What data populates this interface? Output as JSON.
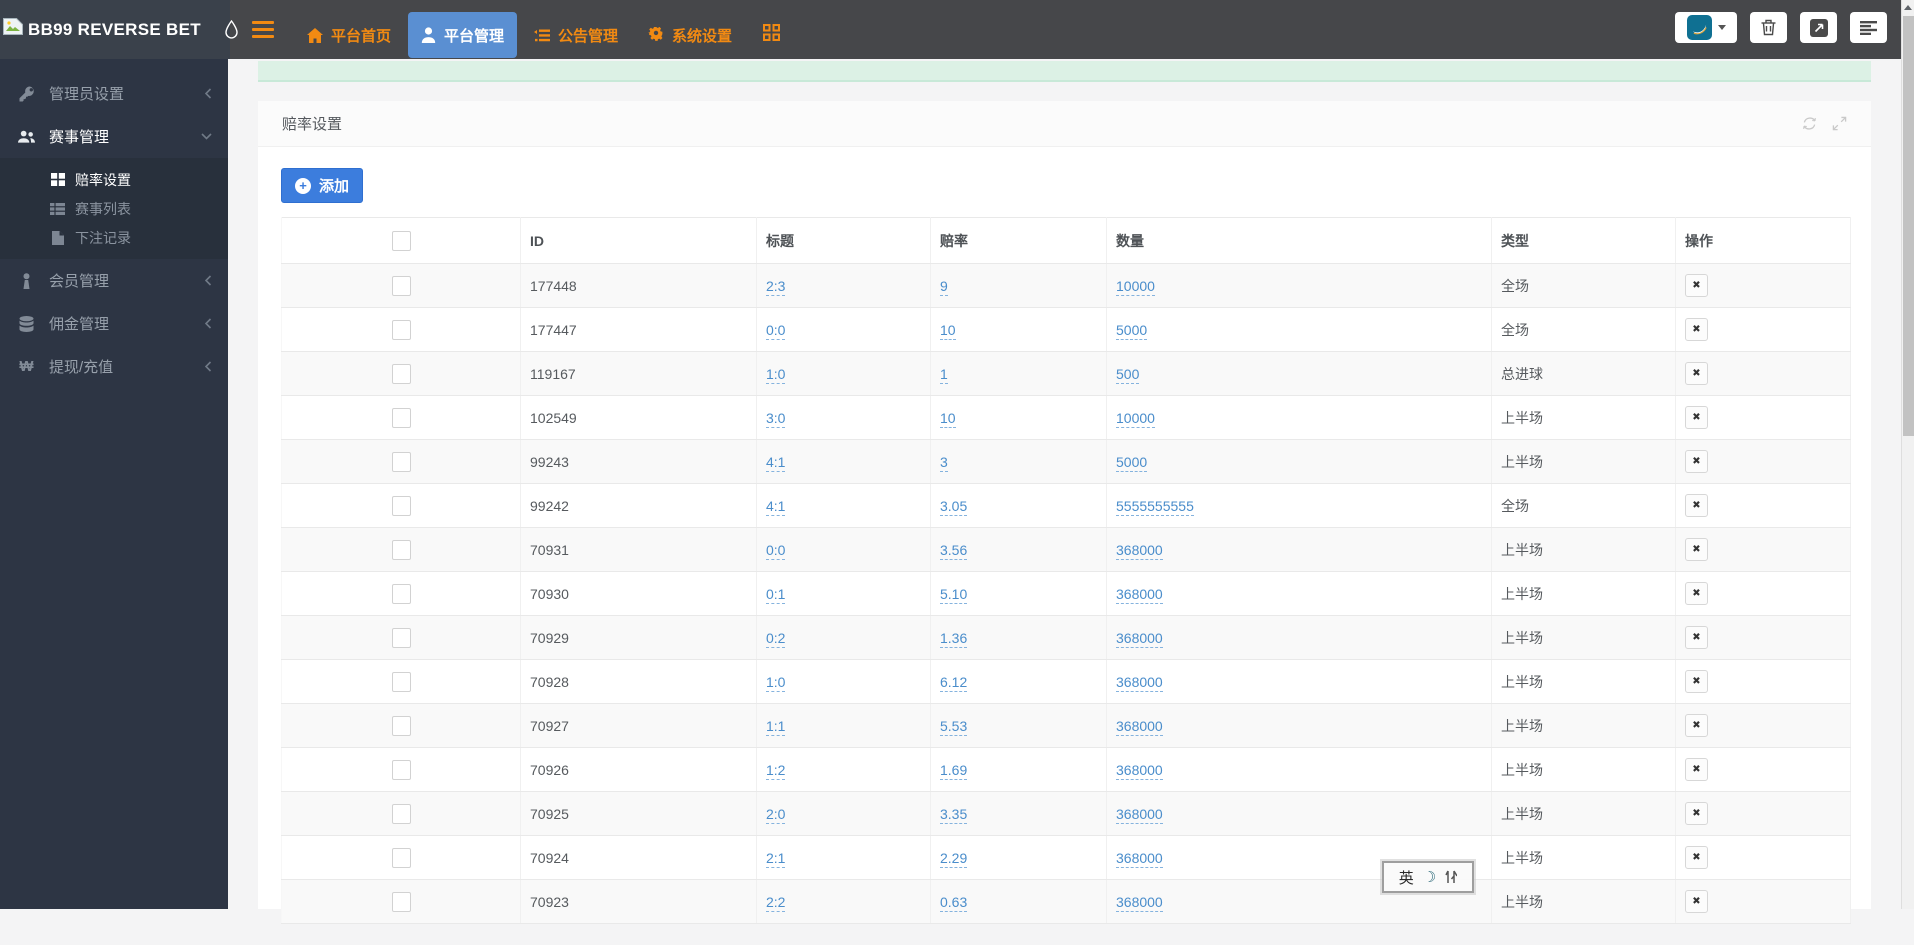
{
  "navbar": {
    "brand": "BB99 REVERSE BET",
    "menu": [
      {
        "label": "平台首页",
        "icon": "home-icon",
        "active": false
      },
      {
        "label": "平台管理",
        "icon": "user-icon",
        "active": true
      },
      {
        "label": "公告管理",
        "icon": "list-icon",
        "active": false
      },
      {
        "label": "系统设置",
        "icon": "gear-icon",
        "active": false
      }
    ],
    "extra_icons": [
      "hamburger-icon",
      "grid-icon",
      "avatar-icon",
      "caret-down-icon",
      "trash-icon",
      "external-link-icon",
      "align-lines-icon"
    ]
  },
  "sidebar": {
    "items": [
      {
        "label": "管理员设置",
        "icon": "key-icon",
        "state": "collapsed"
      },
      {
        "label": "赛事管理",
        "icon": "users-icon",
        "state": "expanded",
        "children": [
          {
            "label": "赔率设置",
            "icon": "th-large-icon",
            "active": true
          },
          {
            "label": "赛事列表",
            "icon": "table-icon",
            "active": false
          },
          {
            "label": "下注记录",
            "icon": "file-icon",
            "active": false
          }
        ]
      },
      {
        "label": "会员管理",
        "icon": "member-icon",
        "state": "collapsed"
      },
      {
        "label": "佣金管理",
        "icon": "database-icon",
        "state": "collapsed"
      },
      {
        "label": "提现/充值",
        "icon": "won-icon",
        "state": "collapsed"
      }
    ]
  },
  "panel": {
    "title": "赔率设置",
    "add_button": "添加",
    "tools": [
      "refresh-icon",
      "expand-icon"
    ]
  },
  "table": {
    "columns": [
      "",
      "ID",
      "标题",
      "赔率",
      "数量",
      "类型",
      "操作"
    ],
    "rows": [
      {
        "id": "177448",
        "title": "2:3",
        "odds": "9",
        "quantity": "10000",
        "type": "全场"
      },
      {
        "id": "177447",
        "title": "0:0",
        "odds": "10",
        "quantity": "5000",
        "type": "全场"
      },
      {
        "id": "119167",
        "title": "1:0",
        "odds": "1",
        "quantity": "500",
        "type": "总进球"
      },
      {
        "id": "102549",
        "title": "3:0",
        "odds": "10",
        "quantity": "10000",
        "type": "上半场"
      },
      {
        "id": "99243",
        "title": "4:1",
        "odds": "3",
        "quantity": "5000",
        "type": "上半场"
      },
      {
        "id": "99242",
        "title": "4:1",
        "odds": "3.05",
        "quantity": "5555555555",
        "type": "全场"
      },
      {
        "id": "70931",
        "title": "0:0",
        "odds": "3.56",
        "quantity": "368000",
        "type": "上半场"
      },
      {
        "id": "70930",
        "title": "0:1",
        "odds": "5.10",
        "quantity": "368000",
        "type": "上半场"
      },
      {
        "id": "70929",
        "title": "0:2",
        "odds": "1.36",
        "quantity": "368000",
        "type": "上半场"
      },
      {
        "id": "70928",
        "title": "1:0",
        "odds": "6.12",
        "quantity": "368000",
        "type": "上半场"
      },
      {
        "id": "70927",
        "title": "1:1",
        "odds": "5.53",
        "quantity": "368000",
        "type": "上半场"
      },
      {
        "id": "70926",
        "title": "1:2",
        "odds": "1.69",
        "quantity": "368000",
        "type": "上半场"
      },
      {
        "id": "70925",
        "title": "2:0",
        "odds": "3.35",
        "quantity": "368000",
        "type": "上半场"
      },
      {
        "id": "70924",
        "title": "2:1",
        "odds": "2.29",
        "quantity": "368000",
        "type": "上半场"
      },
      {
        "id": "70923",
        "title": "2:2",
        "odds": "0.63",
        "quantity": "368000",
        "type": "上半场"
      }
    ],
    "delete_glyph": "✖"
  },
  "ime": {
    "mode": "英",
    "moon_glyph": "☽"
  },
  "colors": {
    "accent_orange": "#f28a12",
    "active_tab_blue": "#5a8fd2",
    "add_button_blue": "#3c7ddd",
    "link_blue": "#4a8dcb",
    "navbar_dark": "#46474a",
    "sidebar_dark": "#2d3544",
    "submenu_dark": "#28303c",
    "alert_green": "#dcf1e5",
    "stripe_grey": "#f9f9f9"
  }
}
